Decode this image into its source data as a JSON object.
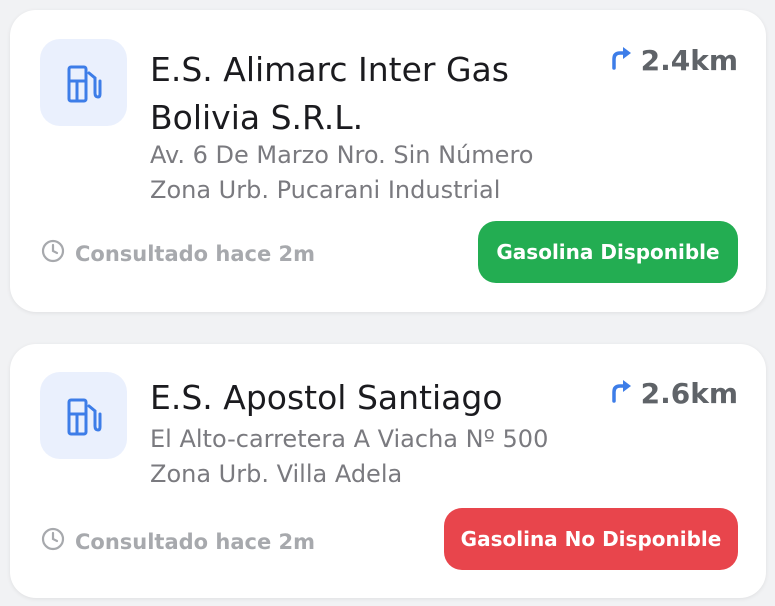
{
  "colors": {
    "available": "#23ad52",
    "unavailable": "#e8454c",
    "accent": "#3d7de8",
    "icon_bg": "#eaf0fd"
  },
  "stations": [
    {
      "name": "E.S. Alimarc Inter Gas Bolivia S.R.L.",
      "distance": "2.4km",
      "address_line1": "Av. 6 De Marzo Nro. Sin Número",
      "address_line2": "Zona Urb. Pucarani Industrial",
      "consulted": "Consultado hace 2m",
      "status": "Gasolina Disponible",
      "icons": [
        "fuel-pump-icon",
        "turn-right-arrow-icon",
        "clock-icon"
      ]
    },
    {
      "name": "E.S. Apostol Santiago",
      "distance": "2.6km",
      "address_line1": "El Alto-carretera A Viacha Nº 500",
      "address_line2": "Zona Urb. Villa Adela",
      "consulted": "Consultado hace 2m",
      "status": "Gasolina No Disponible",
      "icons": [
        "fuel-pump-icon",
        "turn-right-arrow-icon",
        "clock-icon"
      ]
    }
  ]
}
